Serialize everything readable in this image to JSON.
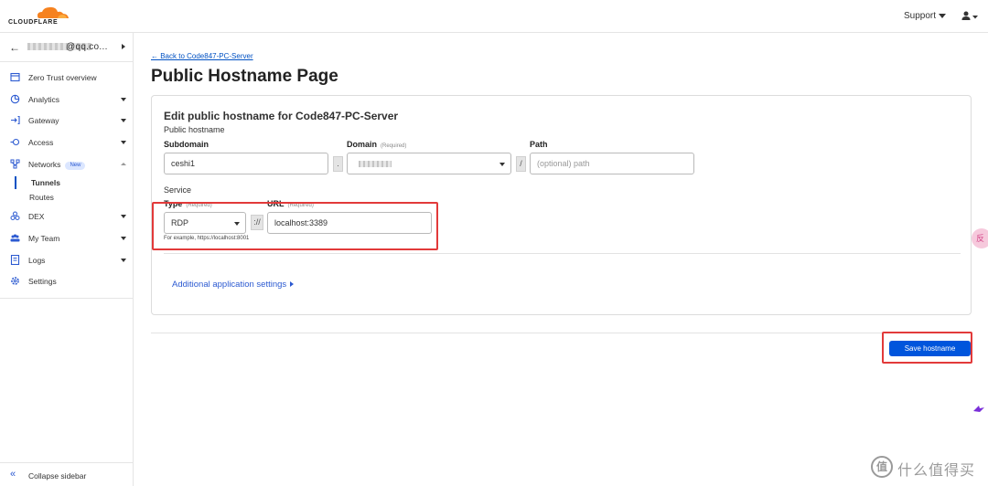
{
  "brand": {
    "name": "CLOUDFLARE"
  },
  "header": {
    "support_label": "Support"
  },
  "account": {
    "name_partial": "@qq.co..."
  },
  "sidebar": {
    "items": [
      {
        "label": "Zero Trust overview",
        "icon": "zero-trust-icon"
      },
      {
        "label": "Analytics",
        "icon": "analytics-icon"
      },
      {
        "label": "Gateway",
        "icon": "gateway-icon"
      },
      {
        "label": "Access",
        "icon": "access-icon"
      },
      {
        "label": "Networks",
        "icon": "networks-icon",
        "badge": "New"
      },
      {
        "label": "DEX",
        "icon": "dex-icon"
      },
      {
        "label": "My Team",
        "icon": "team-icon"
      },
      {
        "label": "Logs",
        "icon": "logs-icon"
      },
      {
        "label": "Settings",
        "icon": "settings-icon"
      }
    ],
    "sub_items": [
      {
        "label": "Tunnels",
        "active": true
      },
      {
        "label": "Routes",
        "active": false
      }
    ],
    "collapse_label": "Collapse sidebar"
  },
  "main": {
    "back_link": "← Back to Code847-PC-Server",
    "page_title": "Public Hostname Page",
    "card_title": "Edit public hostname for Code847-PC-Server",
    "public_hostname_label": "Public hostname",
    "subdomain": {
      "label": "Subdomain",
      "value": "ceshi1"
    },
    "domain": {
      "label": "Domain",
      "required": "(Required)"
    },
    "path": {
      "label": "Path",
      "placeholder": "(optional) path"
    },
    "dot": ".",
    "slash": "/",
    "service_label": "Service",
    "type": {
      "label": "Type",
      "required": "(Required)",
      "value": "RDP"
    },
    "scheme_sep": "://",
    "url": {
      "label": "URL",
      "required": "(Required)",
      "value": "localhost:3389"
    },
    "hint": "For example, https://localhost:8001",
    "additional_settings": "Additional application settings",
    "save_button": "Save hostname"
  },
  "overlay": {
    "watermark_text": "什么值得买",
    "watermark_mark": "值",
    "pink_float_text": "反"
  },
  "colors": {
    "accent": "#0055dc",
    "highlight": "#e23a3a",
    "brand_orange": "#f6821f"
  }
}
